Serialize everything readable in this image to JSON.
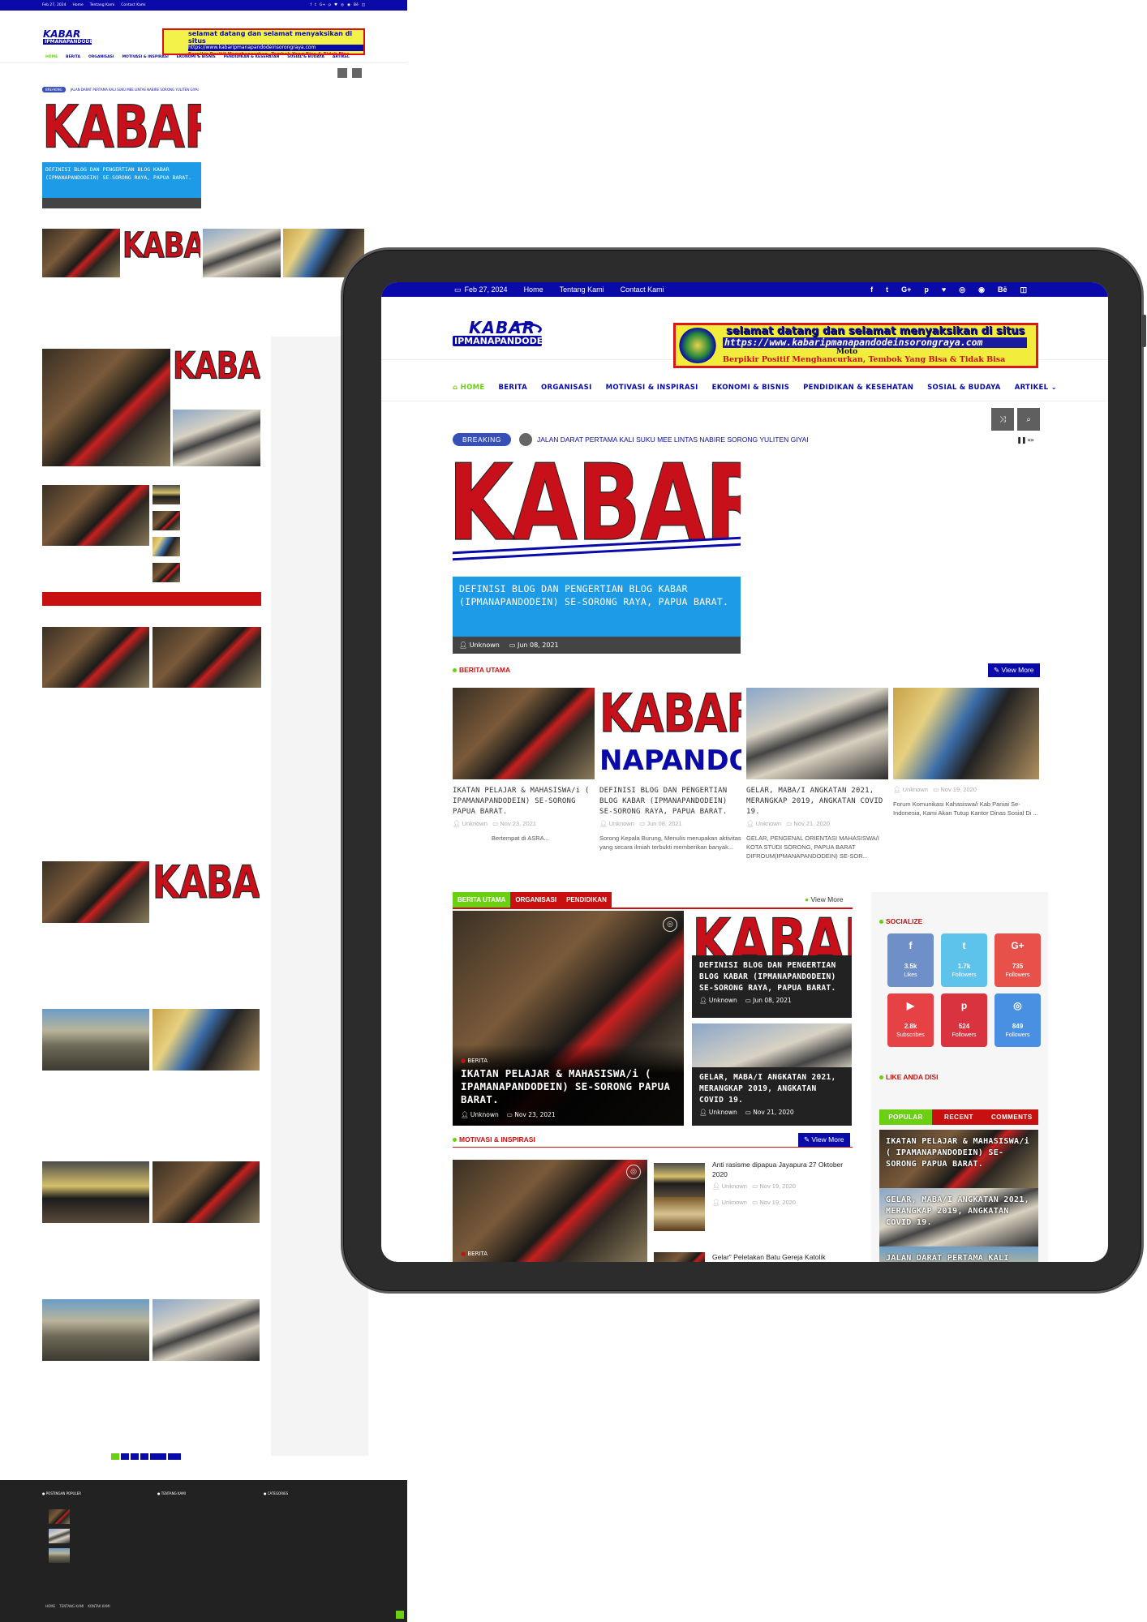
{
  "site": {
    "logo_top": "KABAR",
    "logo_bottom": "IPMANAPANDODEIN",
    "top_date": "Feb 27, 2024",
    "top_links": [
      "Home",
      "Tentang Kami",
      "Contact Kami"
    ],
    "social_icons": [
      "facebook-icon",
      "twitter-icon",
      "google-plus-icon",
      "pinterest-icon",
      "heart-icon",
      "dribbble-icon",
      "instagram-icon",
      "behance-icon",
      "flickr-icon"
    ],
    "social_glyphs": [
      "f",
      "t",
      "G+",
      "p",
      "♥",
      "◎",
      "◉",
      "Bē",
      "◫"
    ]
  },
  "banner": {
    "line1": "selamat datang dan selamat menyaksikan di situs",
    "line2": "https://www.kabaripmanapandodeinsorongraya.com",
    "line3": "Moto",
    "line4": "Berpikir Positif Menghancurkan, Tembok Yang Bisa & Tidak Bisa"
  },
  "nav": {
    "home": "HOME",
    "items": [
      "BERITA",
      "ORGANISASI",
      "MOTIVASI & INSPIRASI",
      "EKONOMI & BISNIS",
      "PENDIDIKAN & KESEHATAN",
      "SOSIAL & BUDAYA",
      "ARTIKEL"
    ],
    "shuffle": "⤨",
    "search": "⌕"
  },
  "breaking": {
    "label": "BREAKING",
    "headline": "JALAN DARAT PERTAMA KALI SUKU MEE LINTAS NABIRE SORONG YULITEN GIYAI",
    "controls": "❚❚ «»"
  },
  "hero": {
    "image_text": "KABAR",
    "title": "DEFINISI BLOG DAN PENGERTIAN BLOG KABAR (IPMANAPANDODEIN) SE-SORONG RAYA, PAPUA BARAT.",
    "author": "Unknown",
    "date": "Jun 08, 2021"
  },
  "berita_utama": {
    "title": "BERITA UTAMA",
    "view_more": "View More",
    "cards": [
      {
        "title": "IKATAN PELAJAR & MAHASISWA/i ( IPAMANAPANDODEIN) SE-SORONG PAPUA BARAT.",
        "author": "Unknown",
        "date": "Nov 23, 2021",
        "snippet": "Bertempat di ASRA..."
      },
      {
        "title": "DEFINISI BLOG DAN PENGERTIAN BLOG KABAR (IPMANAPANDODEIN) SE-SORONG RAYA, PAPUA BARAT.",
        "author": "Unknown",
        "date": "Jun 08, 2021",
        "snippet": "Sorong Kepala Burung, Menulis merupakan aktivitas yang secara ilmiah terbukti memberikan banyak...",
        "image_text": "KABAR"
      },
      {
        "title": "GELAR, MABA/I ANGKATAN 2021, MERANGKAP 2019, ANGKATAN COVID 19.",
        "author": "Unknown",
        "date": "Nov 21, 2020",
        "snippet": "GELAR, PENGENAL ORIENTASI MAHASISWA/I KOTA STUDI SORONG, PAPUA BARAT DIFROUM(IPMANAPANDODEIN) SE-SOR..."
      },
      {
        "title": "",
        "author": "Unknown",
        "date": "Nov 19, 2020",
        "snippet": "Forum Komunikasi Kahasiswa/i Kab Paniai Se-Indonesia, Kami Akan Tutup Kantor Dinas Sosial Di ..."
      }
    ]
  },
  "category_block": {
    "tabs": [
      "BERITA UTAMA",
      "ORGANISASI",
      "PENDIDIKAN"
    ],
    "view_more": "View More",
    "main": {
      "category": "BERITA",
      "title": "IKATAN PELAJAR & MAHASISWA/i ( IPAMANAPANDODEIN) SE-SORONG PAPUA BARAT.",
      "author": "Unknown",
      "date": "Nov 23, 2021"
    },
    "side": [
      {
        "title": "DEFINISI BLOG DAN PENGERTIAN BLOG KABAR (IPMANAPANDODEIN) SE-SORONG RAYA, PAPUA BARAT.",
        "author": "Unknown",
        "date": "Jun 08, 2021",
        "image_text": "KABAR"
      },
      {
        "title": "GELAR, MABA/I ANGKATAN 2021, MERANGKAP 2019, ANGKATAN COVID 19.",
        "author": "Unknown",
        "date": "Nov 21, 2020"
      }
    ]
  },
  "motivasi": {
    "title": "MOTIVASI & INSPIRASI",
    "view_more": "View More",
    "main_category": "BERITA",
    "items": [
      {
        "title": "Anti rasisme dipapua Jayapura 27 Oktober 2020",
        "author": "Unknown",
        "date": "Nov 19, 2020"
      },
      {
        "title": "",
        "author": "Unknown",
        "date": "Nov 19, 2020"
      },
      {
        "title": "Gelar\" Peletakan Batu Gereja Katolik",
        "author": "",
        "date": ""
      }
    ]
  },
  "sidebar": {
    "socialize_title": "SOCIALIZE",
    "tiles": [
      {
        "glyph": "f",
        "count": "3.5k",
        "label": "Likes",
        "color": "#6f8fc8"
      },
      {
        "glyph": "t",
        "count": "1.7k",
        "label": "Followers",
        "color": "#5ec3ea"
      },
      {
        "glyph": "G+",
        "count": "735",
        "label": "Followers",
        "color": "#e8514a"
      },
      {
        "glyph": "▶",
        "count": "2.8k",
        "label": "Subscribes",
        "color": "#e64145"
      },
      {
        "glyph": "p",
        "count": "524",
        "label": "Followers",
        "color": "#d8333f"
      },
      {
        "glyph": "◎",
        "count": "849",
        "label": "Followers",
        "color": "#4a90e2"
      }
    ],
    "like_title": "LIKE ANDA DISI",
    "tabs": [
      "POPULAR",
      "RECENT",
      "COMMENTS"
    ],
    "popular": [
      "IKATAN PELAJAR & MAHASISWA/i ( IPAMANAPANDODEIN) SE-SORONG PAPUA BARAT.",
      "GELAR, MABA/I ANGKATAN 2021, MERANGKAP 2019, ANGKATAN COVID 19.",
      "JALAN DARAT PERTAMA KALI"
    ]
  },
  "colors": {
    "brand_blue": "#0a0aa8",
    "accent_red": "#c81010",
    "accent_green": "#6bcf12",
    "hero_caption": "#1e9be6"
  }
}
